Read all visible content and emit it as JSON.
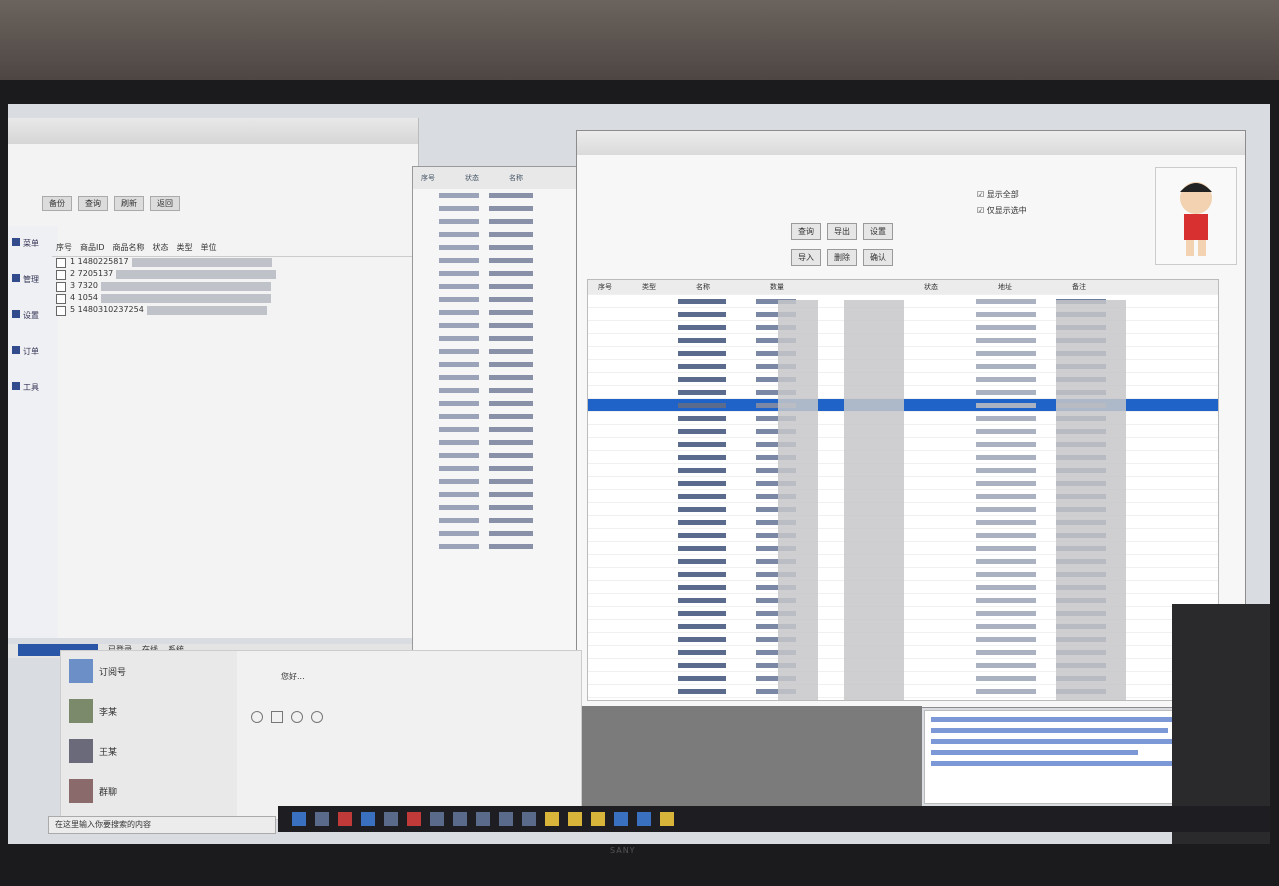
{
  "scene": {
    "monitor_brand": "SANY"
  },
  "left_app": {
    "toolbar": [
      "备份",
      "查询",
      "刷新",
      "返回"
    ],
    "columns": [
      "序号",
      "商品ID",
      "商品名称",
      "状态",
      "类型",
      "单位"
    ],
    "rows": [
      {
        "id": "1",
        "code": "1480225817"
      },
      {
        "id": "2",
        "code": "7205137"
      },
      {
        "id": "3",
        "code": "7320"
      },
      {
        "id": "4",
        "code": "1054"
      },
      {
        "id": "5",
        "code": "1480310237254"
      }
    ],
    "nav": [
      "菜单",
      "管理",
      "设置",
      "订单",
      "工具"
    ],
    "status": [
      "已登录",
      "在线",
      "系统"
    ]
  },
  "mid_list": {
    "header": [
      "序号",
      "状态",
      "名称"
    ]
  },
  "main_window": {
    "buttons_row1": [
      "查询",
      "导出",
      "设置"
    ],
    "buttons_row2": [
      "导入",
      "删除",
      "确认"
    ],
    "checkbox_labels": [
      "显示全部",
      "仅显示选中"
    ],
    "columns": [
      "序号",
      "类型",
      "名称",
      "数量",
      "状态",
      "地址",
      "备注"
    ]
  },
  "chat": {
    "contacts": [
      {
        "name": "订阅号"
      },
      {
        "name": "李某"
      },
      {
        "name": "王某"
      },
      {
        "name": "群聊"
      }
    ],
    "message": "您好..."
  },
  "taskbar": {
    "search_placeholder": "在这里输入你要搜索的内容"
  }
}
